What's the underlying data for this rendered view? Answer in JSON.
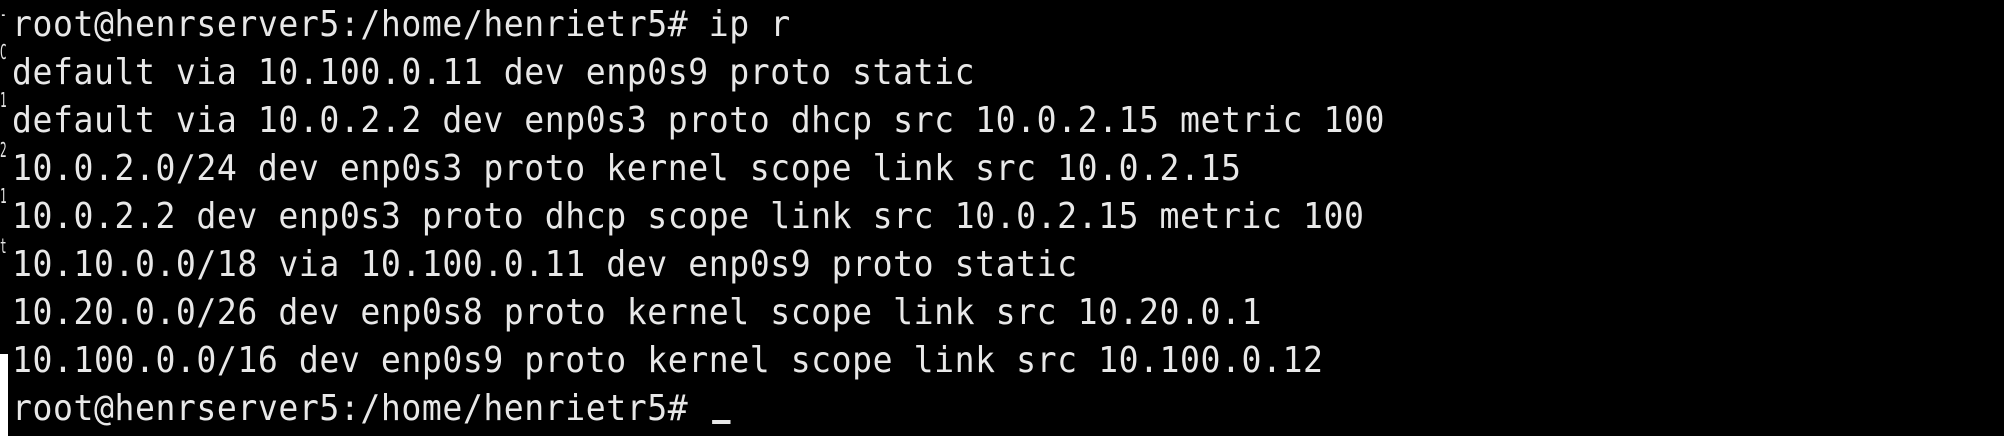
{
  "terminal": {
    "gutter_chars": [
      "-",
      "C",
      "1",
      "2",
      "1",
      "t"
    ],
    "lines": [
      "root@henrserver5:/home/henrietr5# ip r",
      "default via 10.100.0.11 dev enp0s9 proto static",
      "default via 10.0.2.2 dev enp0s3 proto dhcp src 10.0.2.15 metric 100",
      "10.0.2.0/24 dev enp0s3 proto kernel scope link src 10.0.2.15",
      "10.0.2.2 dev enp0s3 proto dhcp scope link src 10.0.2.15 metric 100",
      "10.10.0.0/18 via 10.100.0.11 dev enp0s9 proto static",
      "10.20.0.0/26 dev enp0s8 proto kernel scope link src 10.20.0.1",
      "10.100.0.0/16 dev enp0s9 proto kernel scope link src 10.100.0.12"
    ],
    "prompt": "root@henrserver5:/home/henrietr5# ",
    "colors": {
      "background": "#000000",
      "foreground": "#e8e8e8"
    }
  }
}
